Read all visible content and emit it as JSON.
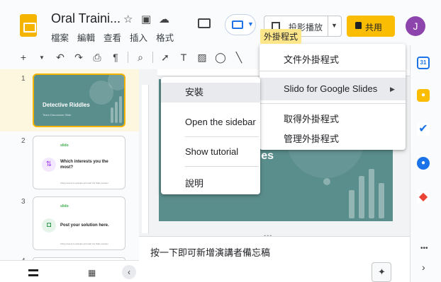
{
  "header": {
    "title": "Oral Traini...",
    "menus": [
      "檔案",
      "編輯",
      "查看",
      "插入",
      "格式"
    ],
    "slideshow_label": "投影播放",
    "share_label": "共用",
    "avatar_letter": "J",
    "tooltip": "外掛程式"
  },
  "slides": {
    "numbers": [
      "1",
      "2",
      "3",
      "4"
    ],
    "s1_title": "Detective Riddles",
    "s1_sub": "Team Discussion Slide",
    "s2_brand": "slido",
    "s2_q": "Which interests you the most?",
    "s2_small": "Click present to activate and start the Slido session",
    "s3_brand": "slido",
    "s3_q": "Post your solution here.",
    "s3_small": "Click present to activate and start the Slido session"
  },
  "main_slide": {
    "title": "dles"
  },
  "notes": {
    "placeholder": "按一下即可新增演講者備忘稿"
  },
  "addons_menu": {
    "items": [
      "文件外掛程式",
      "Slido for Google Slides",
      "取得外掛程式",
      "管理外掛程式"
    ],
    "submenu_arrow": "▶"
  },
  "slido_submenu": {
    "items": [
      "安裝",
      "Open the sidebar",
      "Show tutorial",
      "說明"
    ]
  },
  "toolbar": {
    "icons": [
      "plus-icon",
      "undo-icon",
      "redo-icon",
      "print-icon",
      "paint-format-icon",
      "zoom-icon",
      "select-icon",
      "textbox-icon",
      "image-icon",
      "shape-icon",
      "line-icon"
    ]
  },
  "side_panel": {
    "icons": [
      "calendar-icon",
      "keep-icon",
      "tasks-icon",
      "contacts-icon",
      "maps-icon"
    ],
    "calendar_text": "31"
  },
  "colors": {
    "accent": "#f4b400",
    "slide_bg": "#5a8e8c",
    "share": "#fbbc04"
  }
}
